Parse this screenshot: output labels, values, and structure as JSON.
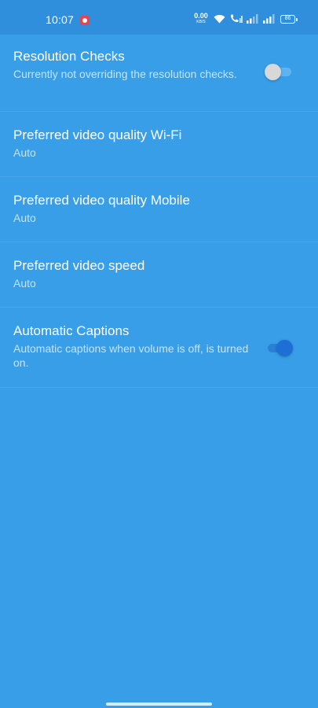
{
  "status_bar": {
    "time": "10:07",
    "net_speed_value": "0.00",
    "net_speed_unit": "KB/S",
    "battery": "86",
    "icons": [
      "screen-record-icon",
      "wifi-icon",
      "volte-call-icon",
      "signal-icon",
      "signal-icon",
      "battery-icon"
    ]
  },
  "settings": {
    "resolution_checks": {
      "title": "Resolution Checks",
      "subtitle": "Currently not overriding the resolution checks.",
      "enabled": false
    },
    "quality_wifi": {
      "title": "Preferred video quality Wi-Fi",
      "value": "Auto"
    },
    "quality_mobile": {
      "title": "Preferred video quality Mobile",
      "value": "Auto"
    },
    "video_speed": {
      "title": "Preferred video speed",
      "value": "Auto"
    },
    "automatic_captions": {
      "title": "Automatic Captions",
      "subtitle": "Automatic captions when volume is off, is turned on.",
      "enabled": true
    }
  },
  "colors": {
    "background": "#389ee8",
    "status_bar": "#2f8fdd",
    "subtitle_text": "#c6e4f8",
    "toggle_on": "#1d6fd6",
    "toggle_off_thumb": "#d8d8d8"
  }
}
